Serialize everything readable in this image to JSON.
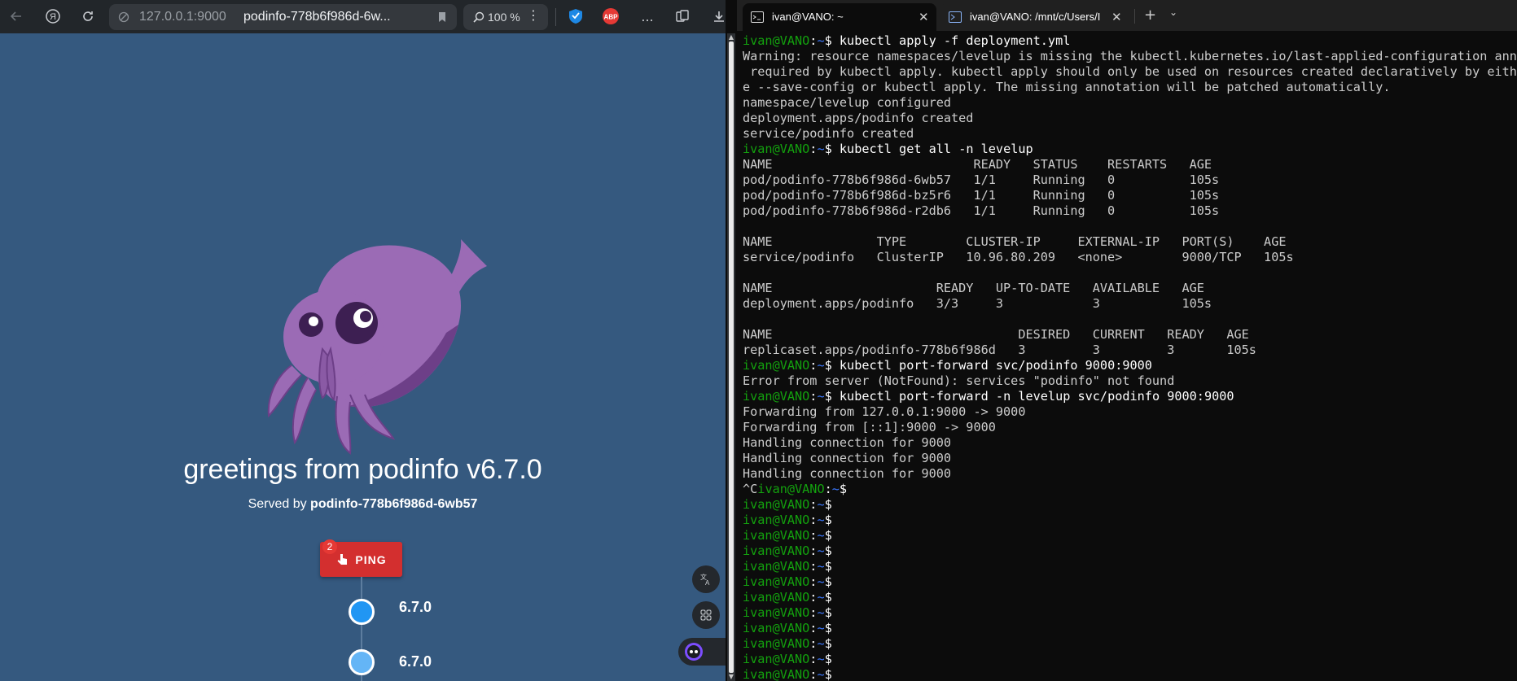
{
  "browser": {
    "address": {
      "host": "127.0.0.1:9000",
      "title": "podinfo-778b6f986d-6w..."
    },
    "zoom": "100 %",
    "icons": [
      "back-icon",
      "yandex-icon",
      "reload-icon",
      "site-info-icon",
      "bookmark-icon",
      "zoom-icon",
      "more-icon",
      "shield-extension-icon",
      "adblock-extension-icon",
      "overflow-icon",
      "collections-icon",
      "download-icon"
    ],
    "adblock_label": "ABP",
    "overflow_label": "...",
    "page": {
      "greeting": "greetings from podinfo v6.7.0",
      "served_prefix": "Served by ",
      "served_pod": "podinfo-778b6f986d-6wb57",
      "ping_label": "PING",
      "ping_count": "2",
      "timeline": [
        {
          "label": "6.7.0",
          "color": "#2196f3"
        },
        {
          "label": "6.7.0",
          "color": "#64b5f6"
        }
      ]
    }
  },
  "terminal": {
    "tabs": [
      {
        "title": "ivan@VANO: ~",
        "active": true
      },
      {
        "title": "ivan@VANO: /mnt/c/Users/Ivan",
        "active": false
      }
    ],
    "new_tab": "+",
    "prompt": {
      "user": "ivan@VANO",
      "colon": ":",
      "path": "~",
      "symbol": "$ "
    },
    "lines": [
      {
        "type": "cmd",
        "text": "kubectl apply -f deployment.yml"
      },
      {
        "type": "out",
        "text": "Warning: resource namespaces/levelup is missing the kubectl.kubernetes.io/last-applied-configuration annot"
      },
      {
        "type": "out",
        "text": " required by kubectl apply. kubectl apply should only be used on resources created declaratively by either"
      },
      {
        "type": "out",
        "text": "e --save-config or kubectl apply. The missing annotation will be patched automatically."
      },
      {
        "type": "out",
        "text": "namespace/levelup configured"
      },
      {
        "type": "out",
        "text": "deployment.apps/podinfo created"
      },
      {
        "type": "out",
        "text": "service/podinfo created"
      },
      {
        "type": "cmd",
        "text": "kubectl get all -n levelup"
      },
      {
        "type": "out",
        "text": "NAME                           READY   STATUS    RESTARTS   AGE"
      },
      {
        "type": "out",
        "text": "pod/podinfo-778b6f986d-6wb57   1/1     Running   0          105s"
      },
      {
        "type": "out",
        "text": "pod/podinfo-778b6f986d-bz5r6   1/1     Running   0          105s"
      },
      {
        "type": "out",
        "text": "pod/podinfo-778b6f986d-r2db6   1/1     Running   0          105s"
      },
      {
        "type": "out",
        "text": ""
      },
      {
        "type": "out",
        "text": "NAME              TYPE        CLUSTER-IP     EXTERNAL-IP   PORT(S)    AGE"
      },
      {
        "type": "out",
        "text": "service/podinfo   ClusterIP   10.96.80.209   <none>        9000/TCP   105s"
      },
      {
        "type": "out",
        "text": ""
      },
      {
        "type": "out",
        "text": "NAME                      READY   UP-TO-DATE   AVAILABLE   AGE"
      },
      {
        "type": "out",
        "text": "deployment.apps/podinfo   3/3     3            3           105s"
      },
      {
        "type": "out",
        "text": ""
      },
      {
        "type": "out",
        "text": "NAME                                 DESIRED   CURRENT   READY   AGE"
      },
      {
        "type": "out",
        "text": "replicaset.apps/podinfo-778b6f986d   3         3         3       105s"
      },
      {
        "type": "cmd",
        "text": "kubectl port-forward svc/podinfo 9000:9000"
      },
      {
        "type": "out",
        "text": "Error from server (NotFound): services \"podinfo\" not found"
      },
      {
        "type": "cmd",
        "text": "kubectl port-forward -n levelup svc/podinfo 9000:9000"
      },
      {
        "type": "out",
        "text": "Forwarding from 127.0.0.1:9000 -> 9000"
      },
      {
        "type": "out",
        "text": "Forwarding from [::1]:9000 -> 9000"
      },
      {
        "type": "out",
        "text": "Handling connection for 9000"
      },
      {
        "type": "out",
        "text": "Handling connection for 9000"
      },
      {
        "type": "out",
        "text": "Handling connection for 9000"
      },
      {
        "type": "cmd",
        "pre": "^C",
        "text": ""
      },
      {
        "type": "cmd",
        "text": ""
      },
      {
        "type": "cmd",
        "text": ""
      },
      {
        "type": "cmd",
        "text": ""
      },
      {
        "type": "cmd",
        "text": ""
      },
      {
        "type": "cmd",
        "text": ""
      },
      {
        "type": "cmd",
        "text": ""
      },
      {
        "type": "cmd",
        "text": ""
      },
      {
        "type": "cmd",
        "text": ""
      },
      {
        "type": "cmd",
        "text": ""
      },
      {
        "type": "cmd",
        "text": ""
      },
      {
        "type": "cmd",
        "text": ""
      },
      {
        "type": "cmd",
        "text": ""
      }
    ]
  },
  "colors": {
    "page_background": "#35597f",
    "ping_button": "#d32f2f",
    "mascot": "#9b6bb5",
    "prompt_user": "#13a10e",
    "prompt_path": "#3b78ff",
    "terminal_background": "#0c0c0c"
  }
}
